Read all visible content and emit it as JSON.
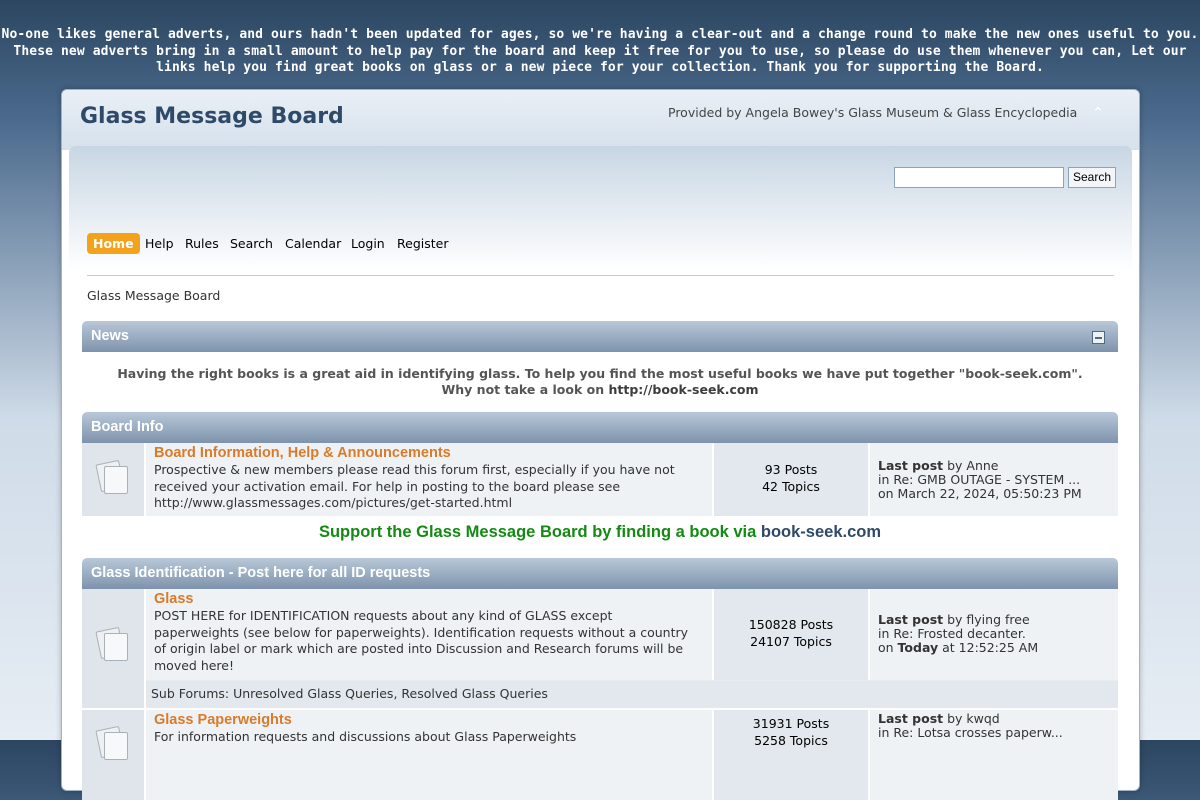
{
  "announcement": "No-one likes general adverts, and ours hadn't been updated for ages, so we're having a clear-out and a change round to make the new ones useful to you. These new adverts bring in a small amount to help pay for the board and keep it free for you to use, so please do use them whenever you can, Let our links help you find great books on glass or a new piece for your collection. Thank you for supporting the Board.",
  "header": {
    "title": "Glass Message Board",
    "provided_by": "Provided by Angela Bowey's Glass Museum & Glass Encyclopedia"
  },
  "search": {
    "value": "",
    "button_label": "Search"
  },
  "menu": {
    "items": [
      "Home",
      "Help",
      "Rules",
      "Search",
      "Calendar",
      "Login",
      "Register"
    ],
    "active": "Home"
  },
  "breadcrumb": "Glass Message Board",
  "news": {
    "title": "News",
    "line1": "Having the right books is a great aid in identifying glass. To help you find the most useful books we have put together \"book-seek.com\".",
    "line2_prefix": "Why not take a look on ",
    "line2_link": "http://book-seek.com"
  },
  "categories": [
    {
      "title": "Board Info",
      "boards": [
        {
          "name": "Board Information, Help & Announcements",
          "description": "Prospective & new members please read this forum first, especially if you have not received your activation email. For help in posting to the board please see http://www.glassmessages.com/pictures/get-started.html",
          "posts": "93 Posts",
          "topics": "42 Topics",
          "last_post_label": "Last post",
          "last_post_by": "by Anne",
          "last_post_in": "in Re: GMB OUTAGE - SYSTEM ...",
          "last_post_on": "on March 22, 2024, 05:50:23 PM"
        }
      ]
    },
    {
      "title": "Glass Identification - Post here for all ID requests",
      "boards": [
        {
          "name": "Glass",
          "description": "POST HERE for IDENTIFICATION requests about any kind of GLASS except paperweights (see below for paperweights). Identification requests without a country of origin label or mark which are posted into Discussion and Research forums will be moved here!",
          "posts": "150828 Posts",
          "topics": "24107 Topics",
          "last_post_label": "Last post",
          "last_post_by": "by flying free",
          "last_post_in": "in Re: Frosted decanter.",
          "last_post_on_prefix": "on ",
          "last_post_on_day": "Today",
          "last_post_on_time": " at 12:52:25 AM",
          "subforums_label": "Sub Forums",
          "subforums": "Unresolved Glass Queries, Resolved Glass Queries"
        },
        {
          "name": "Glass Paperweights",
          "description": "For information requests and discussions about Glass Paperweights",
          "posts": "31931 Posts",
          "topics": "5258 Topics",
          "last_post_label": "Last post",
          "last_post_by": "by kwqd",
          "last_post_in": "in Re: Lotsa crosses paperw..."
        }
      ]
    }
  ],
  "support": {
    "text": "Support the Glass Message Board by finding a book via ",
    "link": "book-seek.com"
  }
}
